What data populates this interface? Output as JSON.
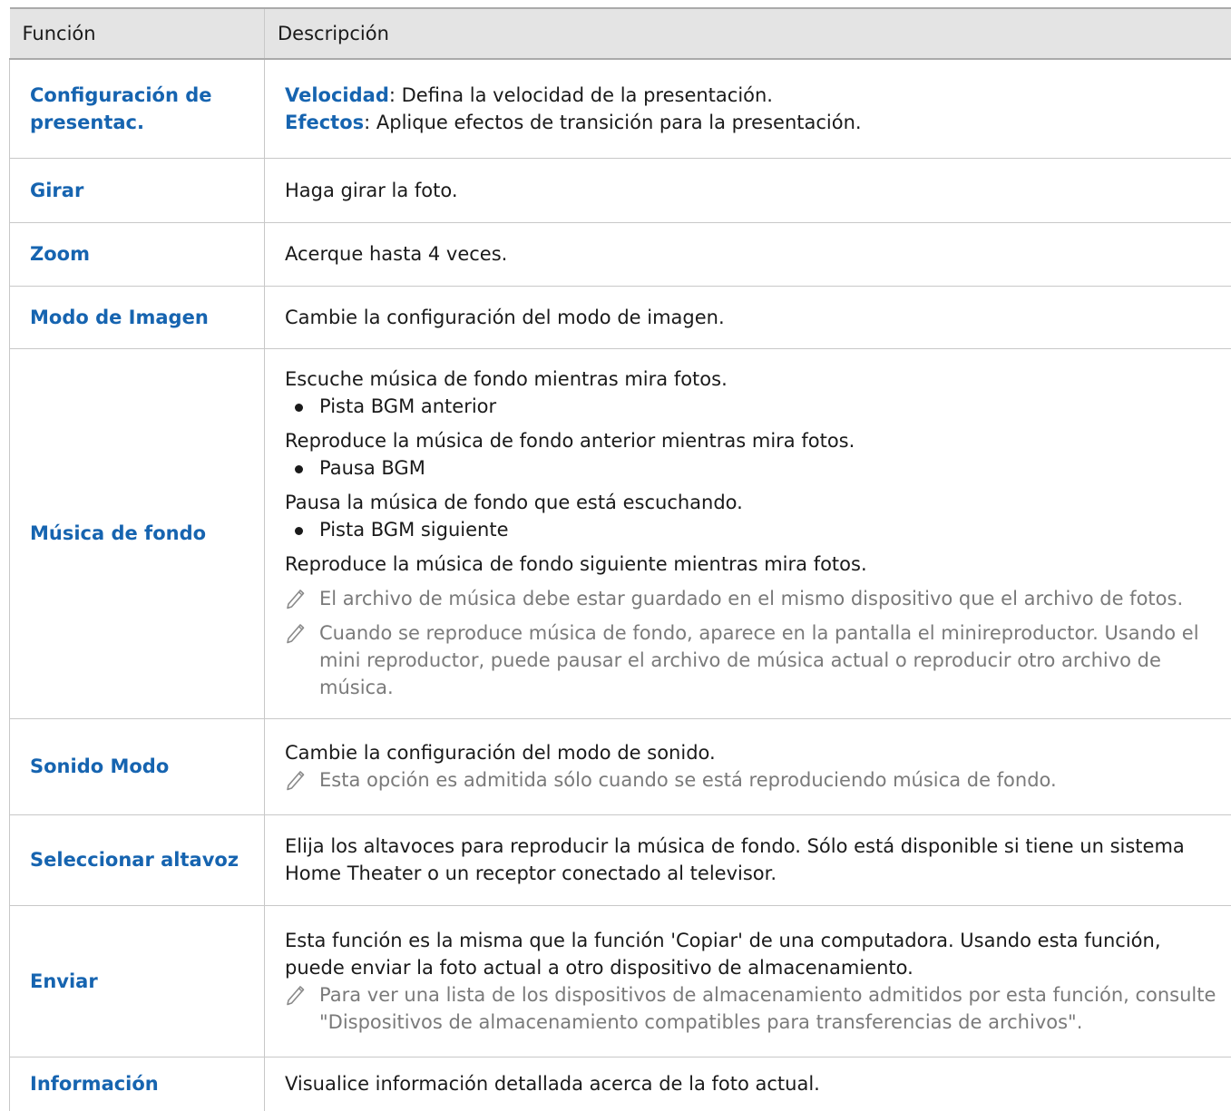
{
  "header": {
    "col1": "Función",
    "col2": "Descripción"
  },
  "rows": [
    {
      "name": "Configuración de presentac.",
      "lines": [
        {
          "kw": "Velocidad",
          "text": ": Defina la velocidad de la presentación."
        },
        {
          "kw": "Efectos",
          "text": ": Aplique efectos de transición para la presentación."
        }
      ]
    },
    {
      "name": "Girar",
      "text": "Haga girar la foto."
    },
    {
      "name": "Zoom",
      "text": "Acerque hasta 4 veces."
    },
    {
      "name": "Modo de Imagen",
      "text": "Cambie la configuración del modo de imagen."
    },
    {
      "name": "Música de fondo",
      "intro": "Escuche música de fondo mientras mira fotos.",
      "items": [
        {
          "bullet": "Pista BGM anterior",
          "desc": "Reproduce la música de fondo anterior mientras mira fotos."
        },
        {
          "bullet": "Pausa BGM",
          "desc": "Pausa la música de fondo que está escuchando."
        },
        {
          "bullet": "Pista BGM siguiente",
          "desc": "Reproduce la música de fondo siguiente mientras mira fotos."
        }
      ],
      "notes": [
        "El archivo de música debe estar guardado en el mismo dispositivo que el archivo de fotos.",
        "Cuando se reproduce música de fondo, aparece en la pantalla el minireproductor. Usando el mini reproductor, puede pausar el archivo de música actual o reproducir otro archivo de música."
      ]
    },
    {
      "name": "Sonido Modo",
      "text": "Cambie la configuración del modo de sonido.",
      "note": "Esta opción es admitida sólo cuando se está reproduciendo música de fondo."
    },
    {
      "name": "Seleccionar altavoz",
      "text": "Elija los altavoces para reproducir la música de fondo. Sólo está disponible si tiene un sistema Home Theater o un receptor conectado al televisor."
    },
    {
      "name": "Enviar",
      "text": "Esta función es la misma que la función 'Copiar' de una computadora. Usando esta función, puede enviar la foto actual a otro dispositivo de almacenamiento.",
      "note": "Para ver una lista de los dispositivos de almacenamiento admitidos por esta función, consulte \"Dispositivos de almacenamiento compatibles para transferencias de archivos\"."
    },
    {
      "name": "Información",
      "text": "Visualice información detallada acerca de la foto actual."
    }
  ],
  "colors": {
    "accent": "#1664b0",
    "header_bg": "#e4e4e4",
    "note_text": "#7a7a7a",
    "border": "#c8c8c8"
  },
  "icons": {
    "note": "pencil-note-icon",
    "bullet": "bullet-dot-icon"
  }
}
